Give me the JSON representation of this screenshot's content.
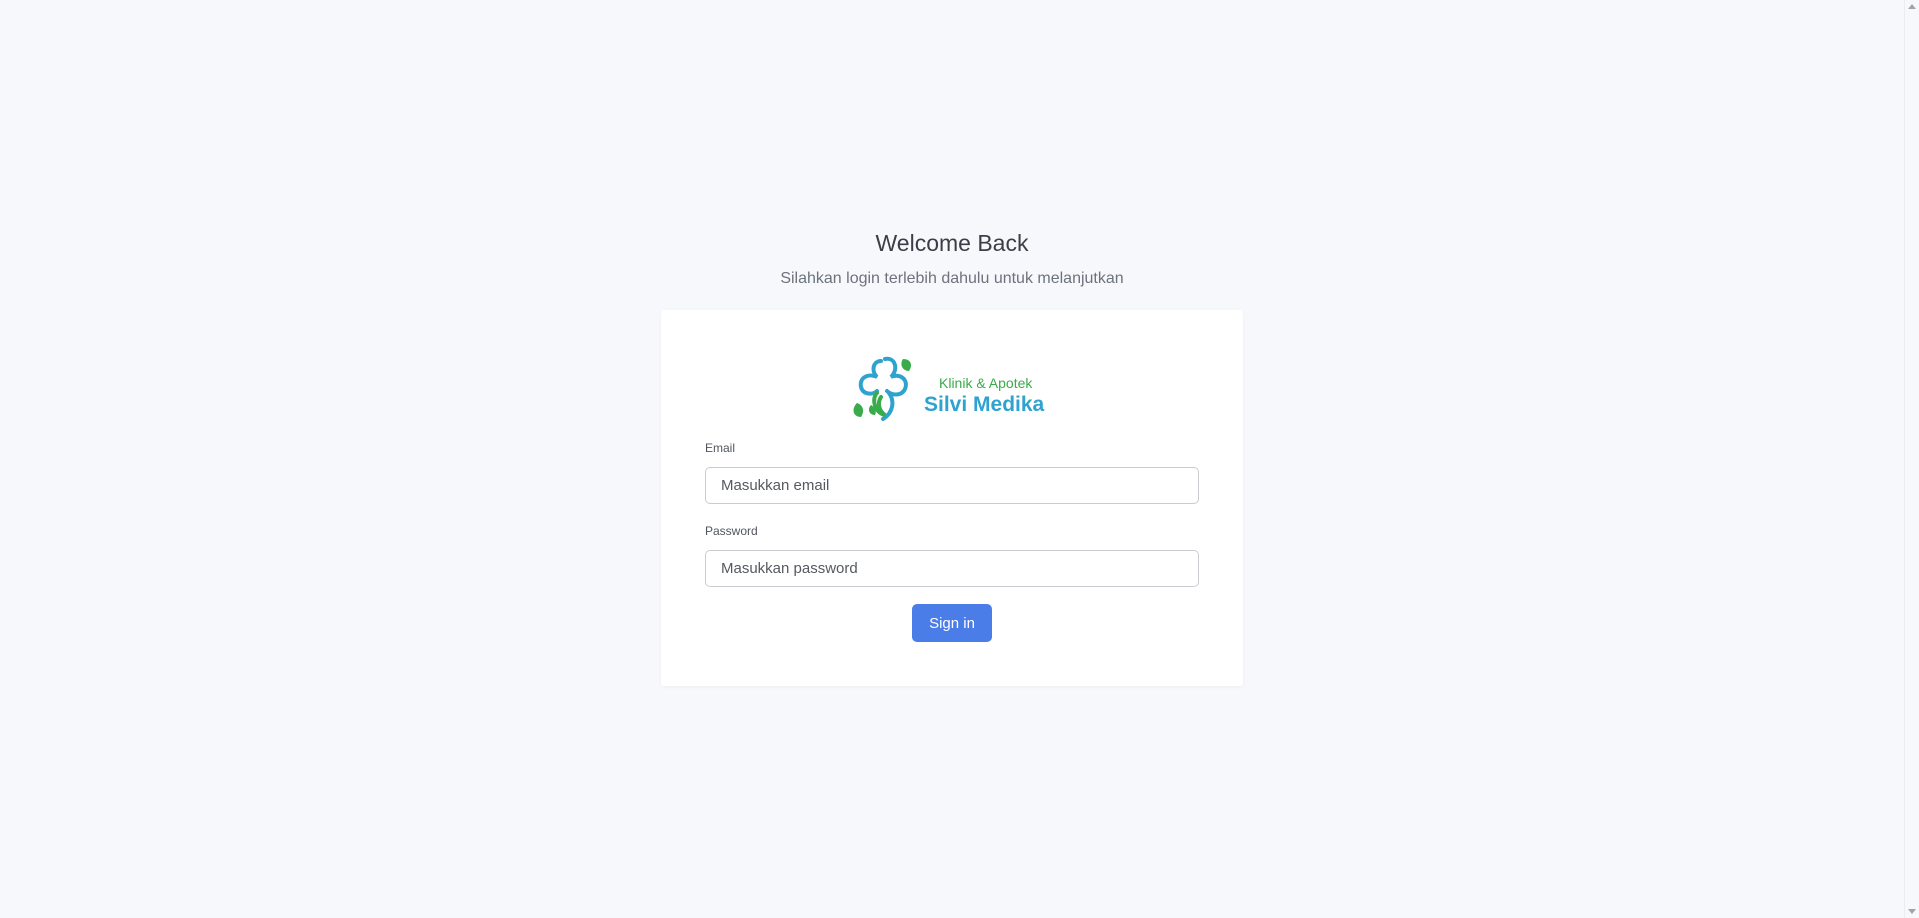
{
  "header": {
    "title": "Welcome Back",
    "subtitle": "Silahkan login terlebih dahulu untuk melanjutkan"
  },
  "logo": {
    "line1": "Klinik & Apotek",
    "line2": "Silvi Medika",
    "colors": {
      "green": "#3aab4a",
      "blue": "#2ea3cf"
    }
  },
  "form": {
    "email_label": "Email",
    "email_placeholder": "Masukkan email",
    "email_value": "",
    "password_label": "Password",
    "password_placeholder": "Masukkan password",
    "password_value": "",
    "submit_label": "Sign in"
  },
  "colors": {
    "background": "#f7f8fb",
    "button": "#4a7de8"
  }
}
